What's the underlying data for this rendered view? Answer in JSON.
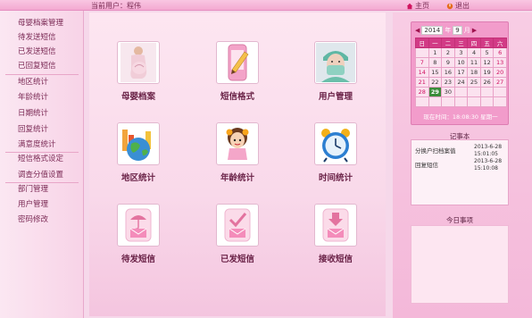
{
  "topbar": {
    "user_label": "当前用户：程伟",
    "home_label": "主页",
    "logout_label": "退出"
  },
  "sidebar": {
    "items": [
      {
        "label": "母婴档案管理"
      },
      {
        "label": "待发送短信"
      },
      {
        "label": "已发送短信"
      },
      {
        "label": "已回复短信"
      },
      {
        "label": "地区统计"
      },
      {
        "label": "年龄统计"
      },
      {
        "label": "日期统计"
      },
      {
        "label": "回复统计"
      },
      {
        "label": "满意度统计"
      },
      {
        "label": "短信格式设定"
      },
      {
        "label": "调查分值设置"
      },
      {
        "label": "部门管理"
      },
      {
        "label": "用户管理"
      },
      {
        "label": "密码修改"
      }
    ]
  },
  "tiles": [
    {
      "label": "母婴档案",
      "icon": "pregnant-woman-icon"
    },
    {
      "label": "短信格式",
      "icon": "phone-pencil-icon"
    },
    {
      "label": "用户管理",
      "icon": "nurse-icon"
    },
    {
      "label": "地区统计",
      "icon": "globe-chart-icon"
    },
    {
      "label": "年龄统计",
      "icon": "child-icon"
    },
    {
      "label": "时间统计",
      "icon": "alarm-clock-icon"
    },
    {
      "label": "待发短信",
      "icon": "envelope-umbrella-icon"
    },
    {
      "label": "已发短信",
      "icon": "envelope-check-icon"
    },
    {
      "label": "接收短信",
      "icon": "envelope-download-icon"
    }
  ],
  "calendar": {
    "year": "2014",
    "year_suffix": "年",
    "month": "9",
    "month_suffix": "月",
    "weekdays": [
      "日",
      "一",
      "二",
      "三",
      "四",
      "五",
      "六"
    ],
    "weeks": [
      [
        "",
        "1",
        "2",
        "3",
        "4",
        "5",
        "6"
      ],
      [
        "7",
        "8",
        "9",
        "10",
        "11",
        "12",
        "13"
      ],
      [
        "14",
        "15",
        "16",
        "17",
        "18",
        "19",
        "20"
      ],
      [
        "21",
        "22",
        "23",
        "24",
        "25",
        "26",
        "27"
      ],
      [
        "28",
        "29",
        "30",
        "",
        "",
        "",
        ""
      ],
      [
        "",
        "",
        "",
        "",
        "",
        "",
        ""
      ]
    ],
    "today": "29",
    "time_label": "现在时间：18:08:30 星期一"
  },
  "memo": {
    "title": "记事本",
    "rows": [
      {
        "text": "分换户扫档案值",
        "date": "2013-6-28"
      },
      {
        "text": "",
        "date": "15:01:05"
      },
      {
        "text": "回复短信",
        "date": "2013-6-28"
      },
      {
        "text": "",
        "date": "15:10:08"
      }
    ]
  },
  "today_events": {
    "title": "今日事项"
  },
  "colors": {
    "accent": "#d23b86",
    "today": "#3a8c3a",
    "sidebar_text": "#7b2a55"
  }
}
